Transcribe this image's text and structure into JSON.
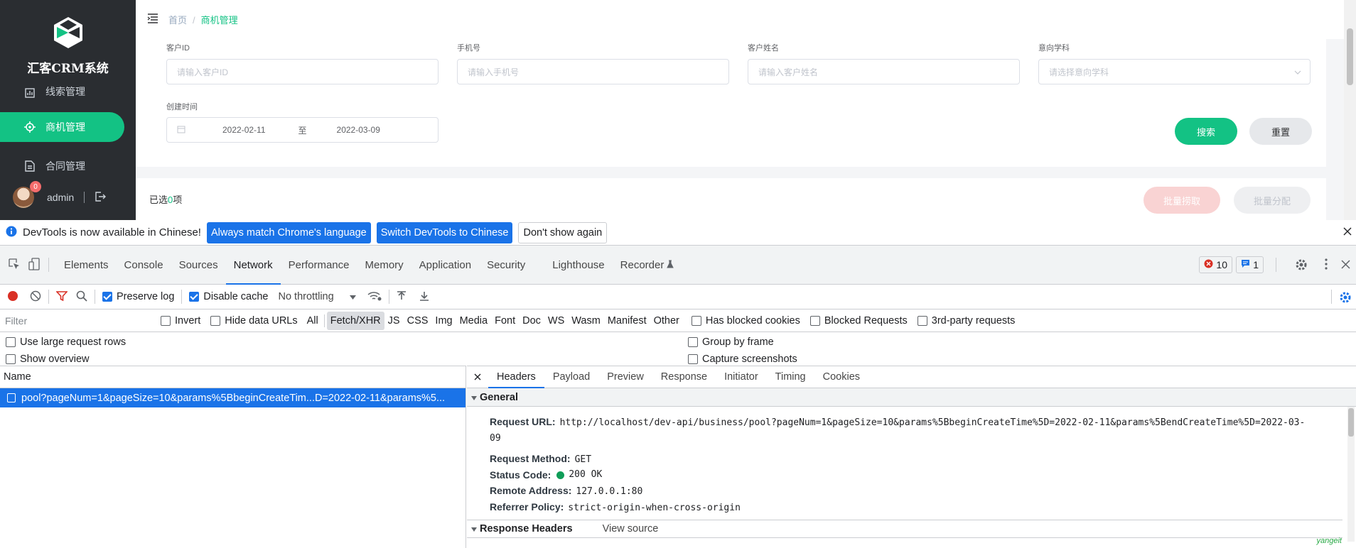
{
  "app": {
    "brand": "汇客CRM系统",
    "menu": [
      {
        "label": "线索管理",
        "icon": "chart-icon"
      },
      {
        "label": "商机管理",
        "icon": "target-icon",
        "active": true
      },
      {
        "label": "合同管理",
        "icon": "document-icon"
      }
    ],
    "user": {
      "name": "admin",
      "badge": "0"
    },
    "breadcrumb": {
      "home": "首页",
      "sep": "/",
      "current": "商机管理"
    },
    "form": {
      "customer_id": {
        "label": "客户ID",
        "placeholder": "请输入客户ID"
      },
      "phone": {
        "label": "手机号",
        "placeholder": "请输入手机号"
      },
      "customer_name": {
        "label": "客户姓名",
        "placeholder": "请输入客户姓名"
      },
      "subject": {
        "label": "意向学科",
        "placeholder": "请选择意向学科"
      },
      "created": {
        "label": "创建时间",
        "start": "2022-02-11",
        "to": "至",
        "end": "2022-03-09"
      },
      "search_btn": "搜索",
      "reset_btn": "重置"
    },
    "selection": {
      "prefix": "已选",
      "count": "0",
      "suffix": "项"
    },
    "batch_fetch": "批量捞取",
    "batch_assign": "批量分配",
    "accent": "#13c284"
  },
  "devtools": {
    "notice": {
      "text": "DevTools is now available in Chinese!",
      "btn1": "Always match Chrome's language",
      "btn2": "Switch DevTools to Chinese",
      "btn3": "Don't show again"
    },
    "tabs": [
      "Elements",
      "Console",
      "Sources",
      "Network",
      "Performance",
      "Memory",
      "Application",
      "Security",
      "Lighthouse",
      "Recorder"
    ],
    "active_tab": "Network",
    "errors": "10",
    "messages": "1",
    "toolbar": {
      "preserve_log": "Preserve log",
      "disable_cache": "Disable cache",
      "throttling": "No throttling"
    },
    "filter": {
      "placeholder": "Filter",
      "invert": "Invert",
      "hide_data_urls": "Hide data URLs",
      "types": [
        "All",
        "Fetch/XHR",
        "JS",
        "CSS",
        "Img",
        "Media",
        "Font",
        "Doc",
        "WS",
        "Wasm",
        "Manifest",
        "Other"
      ],
      "selected_type": "Fetch/XHR",
      "has_blocked_cookies": "Has blocked cookies",
      "blocked_requests": "Blocked Requests",
      "third_party": "3rd-party requests"
    },
    "options": {
      "large_rows": "Use large request rows",
      "group_by_frame": "Group by frame",
      "show_overview": "Show overview",
      "capture_screenshots": "Capture screenshots"
    },
    "list": {
      "header": "Name",
      "request": "pool?pageNum=1&pageSize=10&params%5BbeginCreateTim...D=2022-02-11&params%5..."
    },
    "detail": {
      "tabs": [
        "Headers",
        "Payload",
        "Preview",
        "Response",
        "Initiator",
        "Timing",
        "Cookies"
      ],
      "active_tab": "Headers",
      "general_title": "General",
      "request_url_label": "Request URL:",
      "request_url": "http://localhost/dev-api/business/pool?pageNum=1&pageSize=10&params%5BbeginCreateTime%5D=2022-02-11&params%5BendCreateTime%5D=2022-03-",
      "request_url_cont": "09",
      "method_label": "Request Method:",
      "method": "GET",
      "status_label": "Status Code:",
      "status": "200 OK",
      "remote_label": "Remote Address:",
      "remote": "127.0.0.1:80",
      "referrer_label": "Referrer Policy:",
      "referrer": "strict-origin-when-cross-origin",
      "response_headers_title": "Response Headers",
      "view_source": "View source"
    },
    "watermark": "yangeit"
  }
}
